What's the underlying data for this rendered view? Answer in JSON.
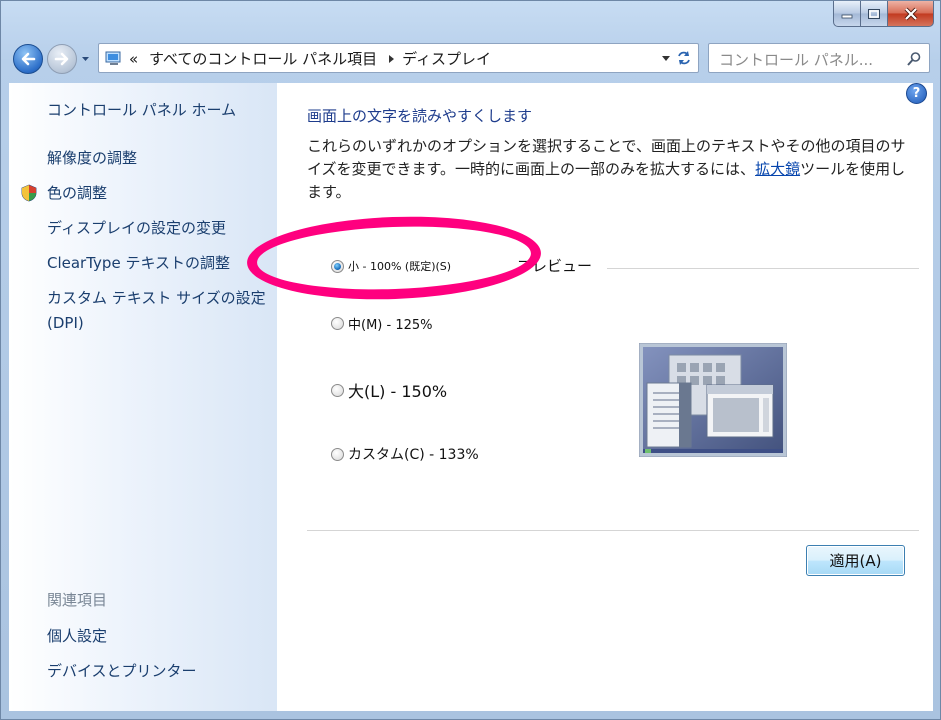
{
  "address_bar": {
    "overflow": "«",
    "crumbs": [
      "すべてのコントロール パネル項目",
      "ディスプレイ"
    ]
  },
  "search": {
    "placeholder": "コントロール パネル..."
  },
  "sidebar": {
    "home": "コントロール パネル ホーム",
    "items": [
      "解像度の調整",
      "色の調整",
      "ディスプレイの設定の変更",
      "ClearType テキストの調整",
      "カスタム テキスト サイズの設定 (DPI)"
    ],
    "related_title": "関連項目",
    "related": [
      "個人設定",
      "デバイスとプリンター"
    ]
  },
  "main": {
    "help": "?",
    "heading": "画面上の文字を読みやすくします",
    "description_before": "これらのいずれかのオプションを選択することで、画面上のテキストやその他の項目のサイズを変更できます。一時的に画面上の一部のみを拡大するには、",
    "description_link": "拡大鏡",
    "description_after": "ツールを使用します。",
    "options": [
      {
        "label": "小 - 100% (既定)(S)",
        "selected": true
      },
      {
        "label": "中(M) - 125%",
        "selected": false
      },
      {
        "label": "大(L) - 150%",
        "selected": false
      },
      {
        "label": "カスタム(C) - 133%",
        "selected": false
      }
    ],
    "preview_label": "プレビュー",
    "apply": "適用(A)"
  },
  "colors": {
    "annotation": "#ff007f",
    "link": "#1a3e6e",
    "heading": "#1e3c8c"
  }
}
